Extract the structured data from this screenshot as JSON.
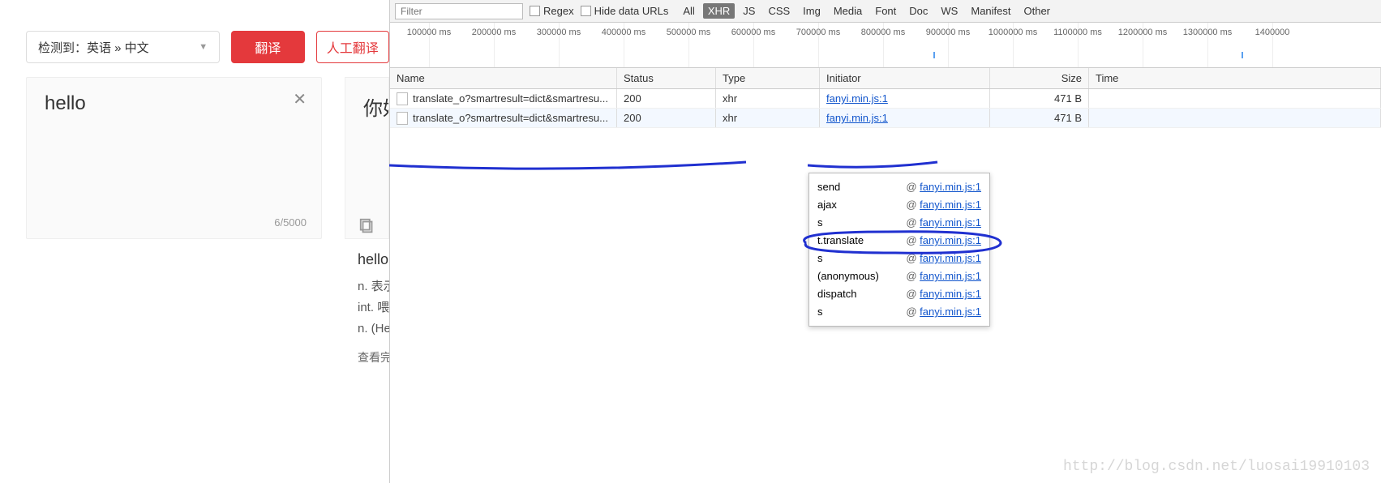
{
  "left": {
    "lang_detect": "检测到：英语 » 中文",
    "translate_btn": "翻译",
    "human_btn": "人工翻译",
    "src_text": "hello",
    "counter": "6/5000",
    "dst_text": "你好",
    "dict_head": "hello",
    "dict_lines": [
      "n. 表示",
      "int. 喂",
      "n. (He"
    ],
    "dict_more": "查看完"
  },
  "dev": {
    "filter_placeholder": "Filter",
    "regex": "Regex",
    "hide": "Hide data URLs",
    "tabs": [
      "All",
      "XHR",
      "JS",
      "CSS",
      "Img",
      "Media",
      "Font",
      "Doc",
      "WS",
      "Manifest",
      "Other"
    ],
    "active_tab": "XHR",
    "ticks": [
      "100000 ms",
      "200000 ms",
      "300000 ms",
      "400000 ms",
      "500000 ms",
      "600000 ms",
      "700000 ms",
      "800000 ms",
      "900000 ms",
      "1000000 ms",
      "1100000 ms",
      "1200000 ms",
      "1300000 ms",
      "1400000"
    ],
    "cols": {
      "name": "Name",
      "status": "Status",
      "type": "Type",
      "init": "Initiator",
      "size": "Size",
      "time": "Time"
    },
    "rows": [
      {
        "name": "translate_o?smartresult=dict&smartresu...",
        "status": "200",
        "type": "xhr",
        "init": "fanyi.min.js:1",
        "size": "471 B"
      },
      {
        "name": "translate_o?smartresult=dict&smartresu...",
        "status": "200",
        "type": "xhr",
        "init": "fanyi.min.js:1",
        "size": "471 B"
      }
    ],
    "popup": [
      {
        "fn": "send",
        "src": "fanyi.min.js:1"
      },
      {
        "fn": "ajax",
        "src": "fanyi.min.js:1"
      },
      {
        "fn": "s",
        "src": "fanyi.min.js:1"
      },
      {
        "fn": "t.translate",
        "src": "fanyi.min.js:1"
      },
      {
        "fn": "s",
        "src": "fanyi.min.js:1"
      },
      {
        "fn": "(anonymous)",
        "src": "fanyi.min.js:1"
      },
      {
        "fn": "dispatch",
        "src": "fanyi.min.js:1"
      },
      {
        "fn": "s",
        "src": "fanyi.min.js:1"
      }
    ]
  },
  "watermark": "http://blog.csdn.net/luosai19910103"
}
